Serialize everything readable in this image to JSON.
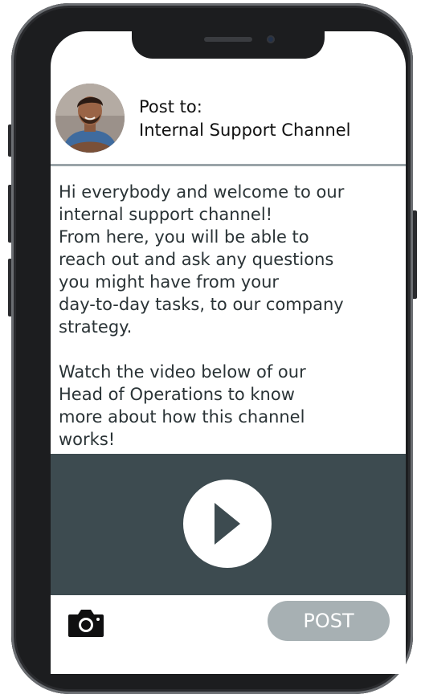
{
  "header": {
    "post_to_label": "Post to:",
    "channel_name": "Internal Support Channel"
  },
  "message": {
    "body": "Hi everybody and welcome to our\ninternal support channel!\nFrom here, you will be able to\nreach out and ask any questions\nyou might have from your\nday-to-day tasks, to our company\nstrategy.\n\nWatch the video below of our\nHead of Operations to know\nmore about how this channel\nworks!"
  },
  "video": {
    "play_icon": "play-icon",
    "background_color": "#3d4b50"
  },
  "actions": {
    "camera_icon": "camera-icon",
    "post_label": "POST",
    "post_button_color": "#a7b0b3"
  },
  "colors": {
    "divider": "#9aa4a8",
    "text": "#2a3336"
  }
}
